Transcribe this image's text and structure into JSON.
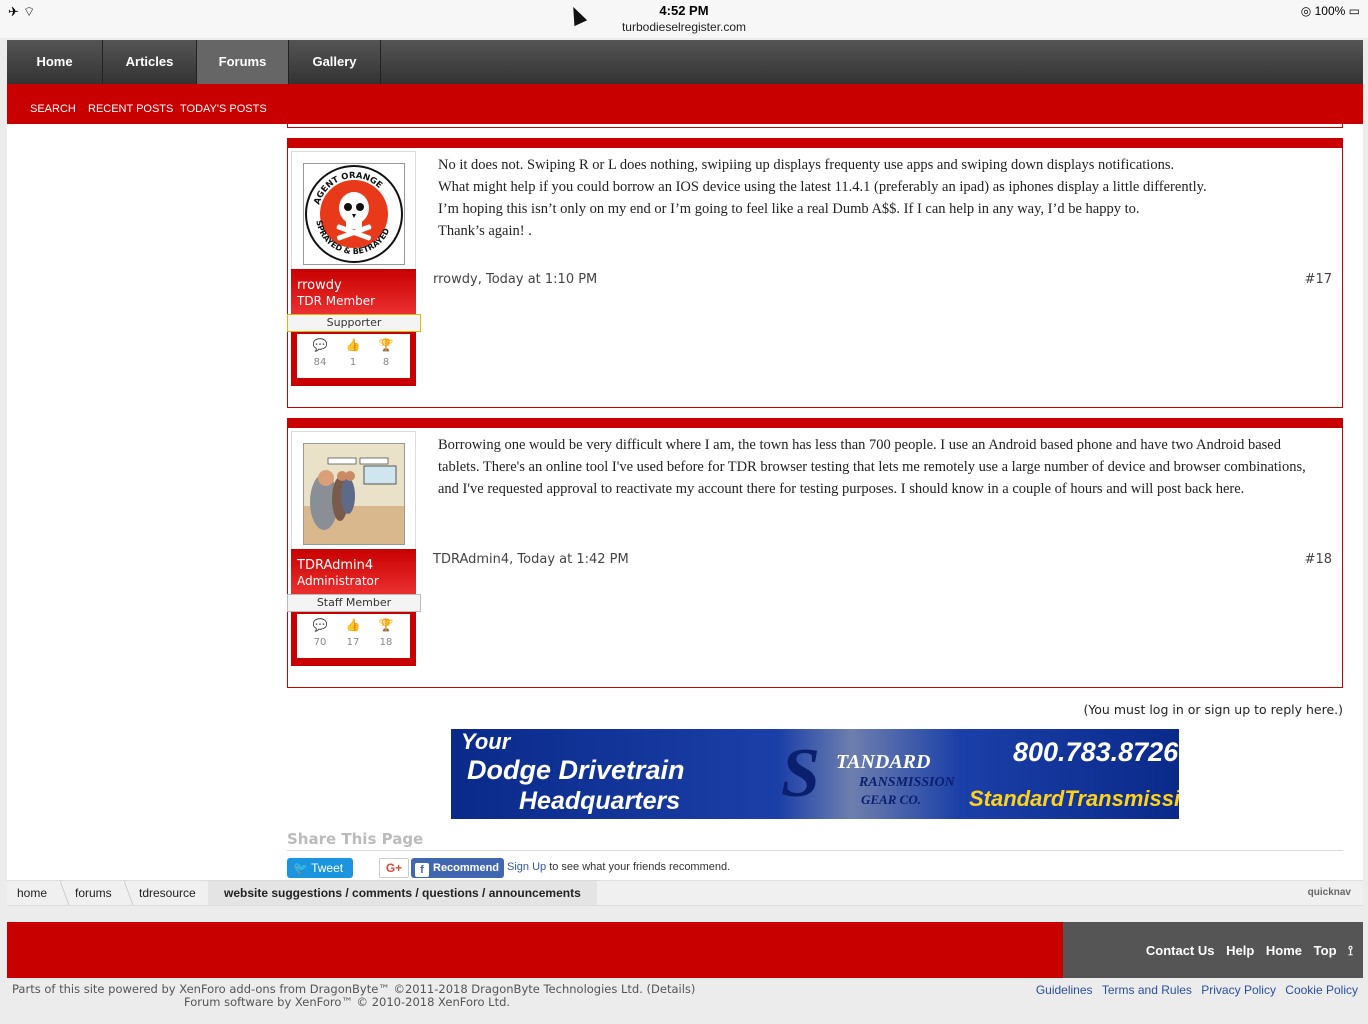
{
  "status": {
    "time": "4:52 PM",
    "url": "turbodieselregister.com",
    "battery": "100%"
  },
  "nav": {
    "tabs": [
      "Home",
      "Articles",
      "Forums",
      "Gallery"
    ],
    "active": "Forums"
  },
  "subnav": [
    "SEARCH",
    "RECENT POSTS",
    "TODAY'S POSTS"
  ],
  "posts": [
    {
      "username": "rrowdy",
      "usertitle": "TDR Member",
      "badge": "Supporter",
      "stats": [
        "84",
        "1",
        "8"
      ],
      "message": [
        "No it does not. Swiping R or L does nothing, swipiing up displays frequenty use apps and swiping down displays notifications.",
        "What might help if you could borrow an IOS device using the latest 11.4.1 (preferably an ipad) as iphones display a little differently.",
        "I’m hoping this isn’t only on my end or I’m going to feel like a real Dumb A$$. If I can help in any way, I’d be happy to.",
        "Thank’s again! ."
      ],
      "meta": "rrowdy, Today at 1:10 PM",
      "permalink": "#17",
      "avatar_text": {
        "top": "AGENT ORANGE",
        "bottom": "SPRAYED & BETRAYED"
      }
    },
    {
      "username": "TDRAdmin4",
      "usertitle": "Administrator",
      "badge": "Staff Member",
      "stats": [
        "70",
        "17",
        "18"
      ],
      "message": [
        "Borrowing one would be very difficult where I am, the town has less than 700 people. I use an Android based phone and have two Android based",
        "tablets. There's an online tool I've used before for TDR browser testing that lets me remotely use a large number of device and browser combinations,",
        "and I've requested approval to reactivate my account there for testing purposes. I should know in a couple of hours and will post back here."
      ],
      "meta": "TDRAdmin4, Today at 1:42 PM",
      "permalink": "#18"
    }
  ],
  "login_note": "(You must log in or sign up to reply here.)",
  "banner": {
    "line1": "Your",
    "line2": "Dodge Drivetrain",
    "line3": "Headquarters",
    "logo_std": "TANDARD",
    "logo_trans": "RANSMISSION",
    "logo_gear": "GEAR CO.",
    "phone": "800.783.8726",
    "url": "StandardTransmission.com"
  },
  "share": {
    "title": "Share This Page",
    "tweet": "Tweet",
    "gplus": "G+",
    "recommend": "Recommend",
    "signup": "Sign Up",
    "signup_rest": " to see what your friends recommend."
  },
  "breadcrumb": [
    "home",
    "forums",
    "tdresource",
    "website suggestions / comments / questions / announcements"
  ],
  "quicknav": "quicknav",
  "footer_links": [
    "Contact Us",
    "Help",
    "Home",
    "Top"
  ],
  "copyright": {
    "line1": "Parts of this site powered by XenForo add-ons from DragonByte™ ©2011-2018 DragonByte Technologies Ltd. (Details)",
    "line2": "Forum software by XenForo™ © 2010-2018 XenForo Ltd."
  },
  "legal": [
    "Guidelines",
    "Terms and Rules",
    "Privacy Policy",
    "Cookie Policy"
  ],
  "colors": {
    "brand_red": "#c80000",
    "nav_dark": "#333333",
    "link_blue": "#2a4fa0"
  }
}
